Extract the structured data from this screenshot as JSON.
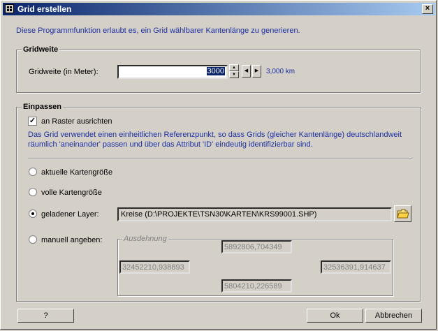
{
  "window": {
    "title": "Grid erstellen",
    "close_glyph": "×"
  },
  "intro_text": "Diese Programmfunktion erlaubt es, ein Grid wählbarer Kantenlänge zu generieren.",
  "gridweite": {
    "group_title": "Gridweite",
    "label": "Gridweite (in Meter):",
    "value": "3000",
    "km_readout": "3,000 km",
    "spin_up": "▲",
    "spin_down": "▼",
    "prev": "◀",
    "next": "▶"
  },
  "einpassen": {
    "group_title": "Einpassen",
    "checkbox_label": "an Raster ausrichten",
    "checkbox_checked": true,
    "checkbox_glyph": "✓",
    "description_line1": "Das Grid verwendet einen einheitlichen Referenzpunkt, so dass Grids (gleicher Kantenlänge) deutschlandweit",
    "description_line2": "räumlich 'aneinander' passen und über das Attribut 'ID' eindeutig identifizierbar sind.",
    "options": {
      "aktuelle": "aktuelle Kartengröße",
      "volle": "volle Kartengröße",
      "layer": "geladener Layer:",
      "manuell": "manuell angeben:"
    },
    "selected_option": "layer",
    "layer_value": "Kreise (D:\\PROJEKTE\\TSN30\\KARTEN\\KRS99001.SHP)",
    "ausdehnung": {
      "title": "Ausdehnung",
      "top": "5892806,704349",
      "left": "32452210,938893",
      "right": "32536391,914637",
      "bottom": "5804210,226589"
    }
  },
  "buttons": {
    "help": "?",
    "ok": "Ok",
    "cancel": "Abbrechen"
  },
  "colors": {
    "title_start": "#0a246a",
    "title_end": "#a6caf0",
    "info_text": "#1b2fa1",
    "face": "#d4d0c8"
  }
}
